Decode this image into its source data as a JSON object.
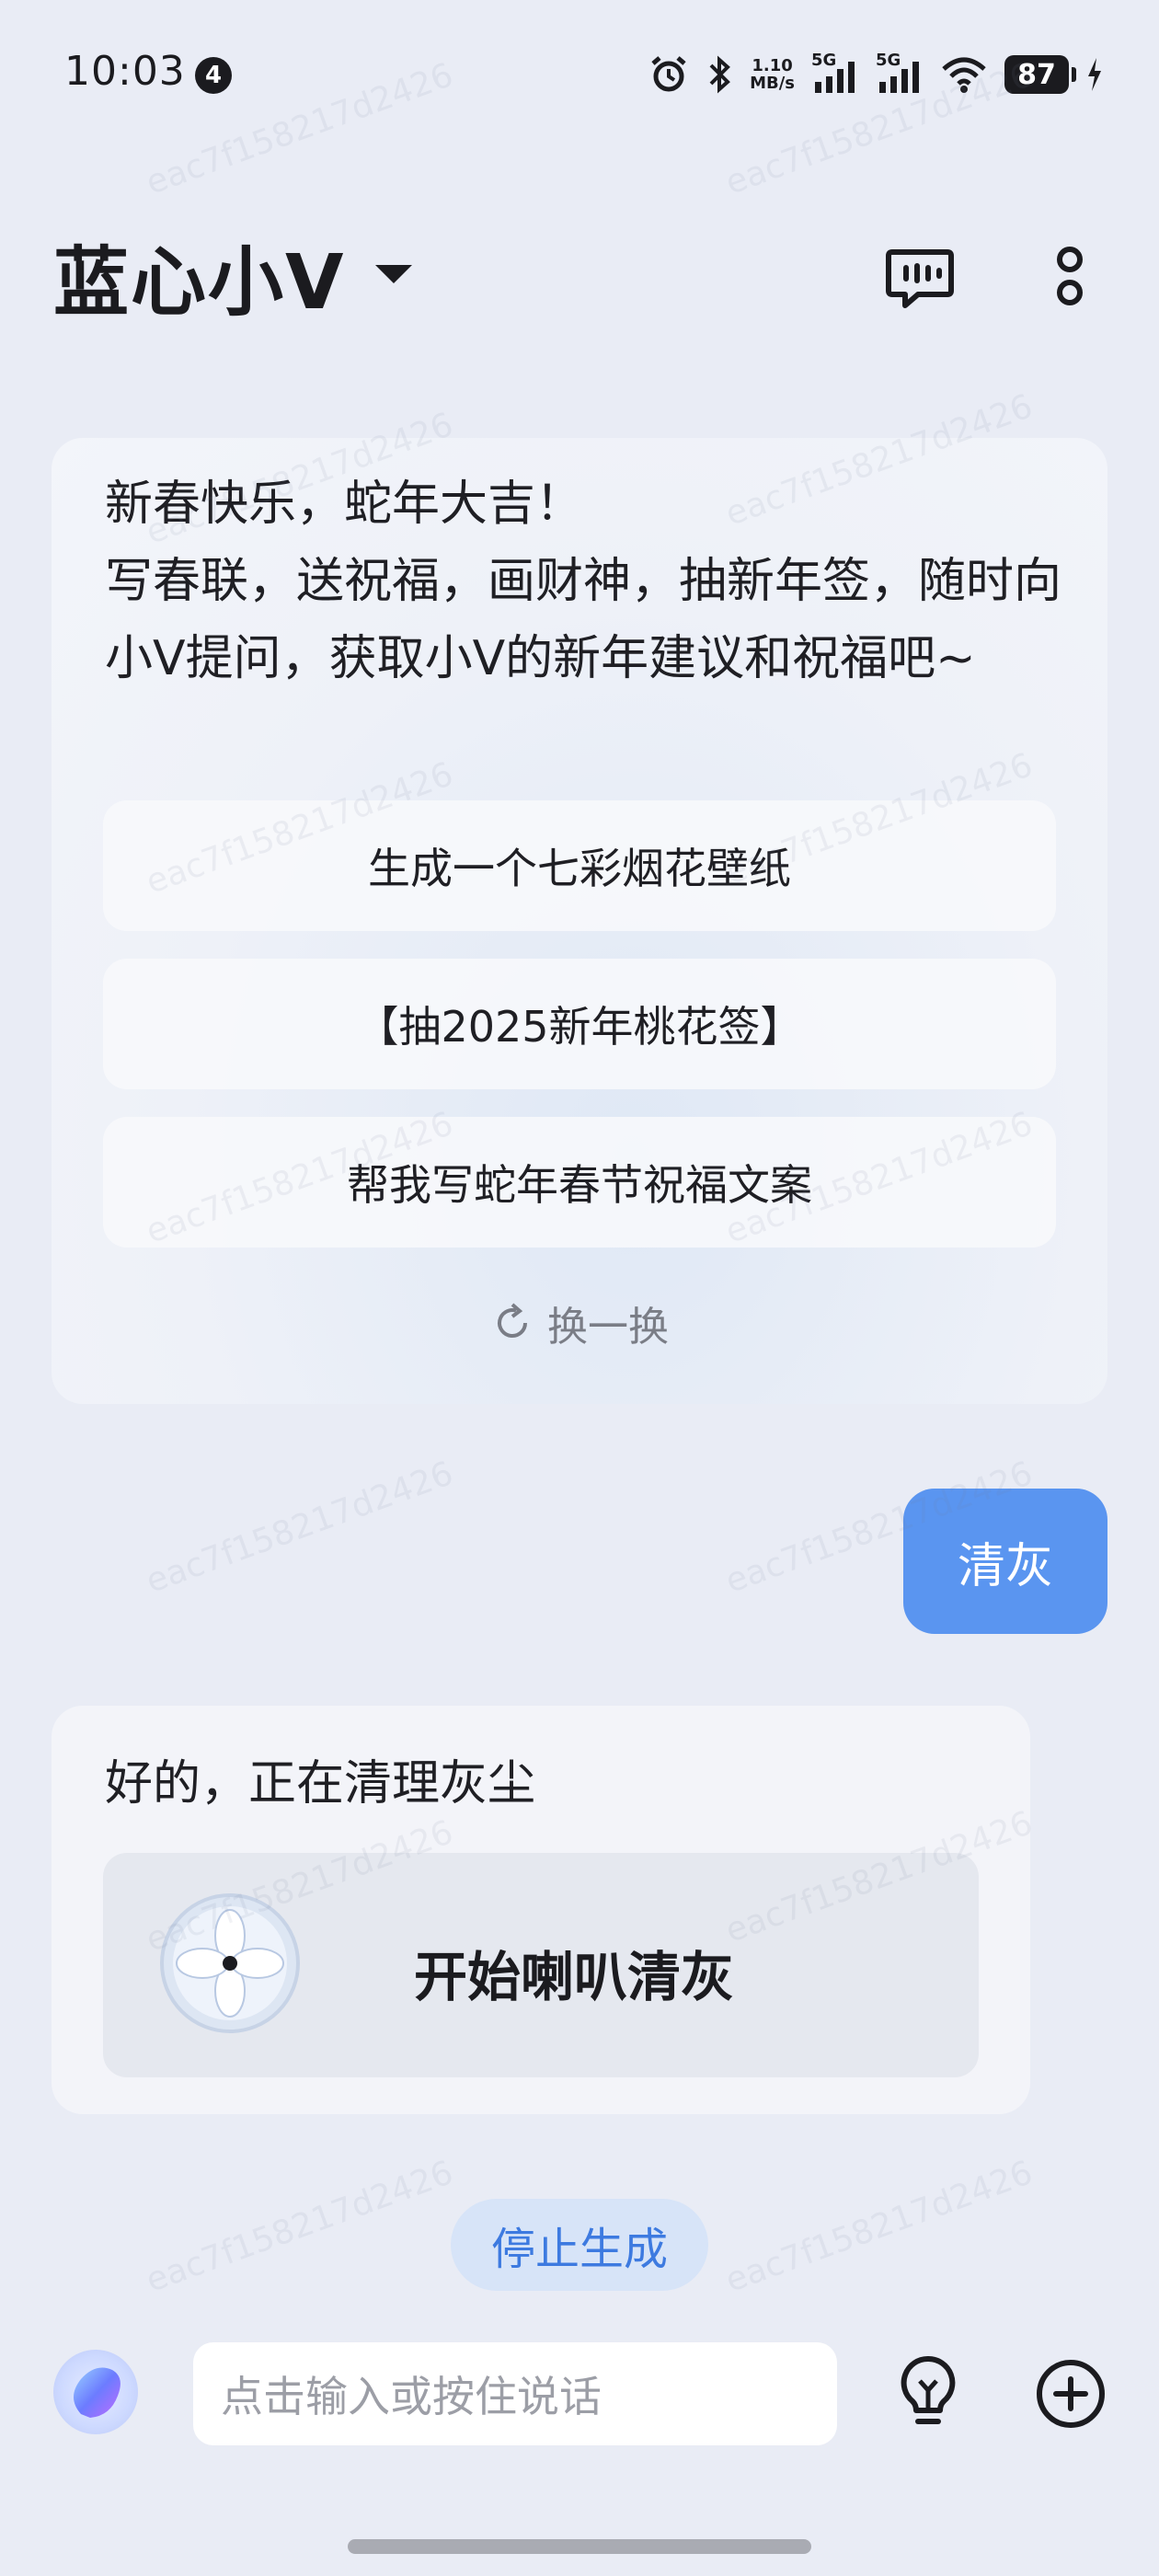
{
  "status_bar": {
    "time": "10:03",
    "notification_count": "4",
    "net_speed_value": "1.10",
    "net_speed_unit": "MB/s",
    "sim1_label": "5G",
    "sim2_label": "5G",
    "battery": "87"
  },
  "header": {
    "title": "蓝心小V"
  },
  "greeting": {
    "text": "新春快乐，蛇年大吉！\n写春联，送祝福，画财神，抽新年签，随时向小V提问，获取小V的新年建议和祝福吧~",
    "suggestions": [
      "生成一个七彩烟花壁纸",
      "【抽2025新年桃花签】",
      "帮我写蛇年春节祝福文案"
    ],
    "refresh_label": "换一换"
  },
  "user_message": "清灰",
  "reply": {
    "text": "好的，正在清理灰尘",
    "action_label": "开始喇叭清灰"
  },
  "stop_button": "停止生成",
  "input": {
    "placeholder": "点击输入或按住说话"
  },
  "watermark": "eac7f158217d2426",
  "colors": {
    "background": "#e9ecf5",
    "accent_blue": "#5a95f0",
    "stop_text": "#3d7ae0"
  }
}
